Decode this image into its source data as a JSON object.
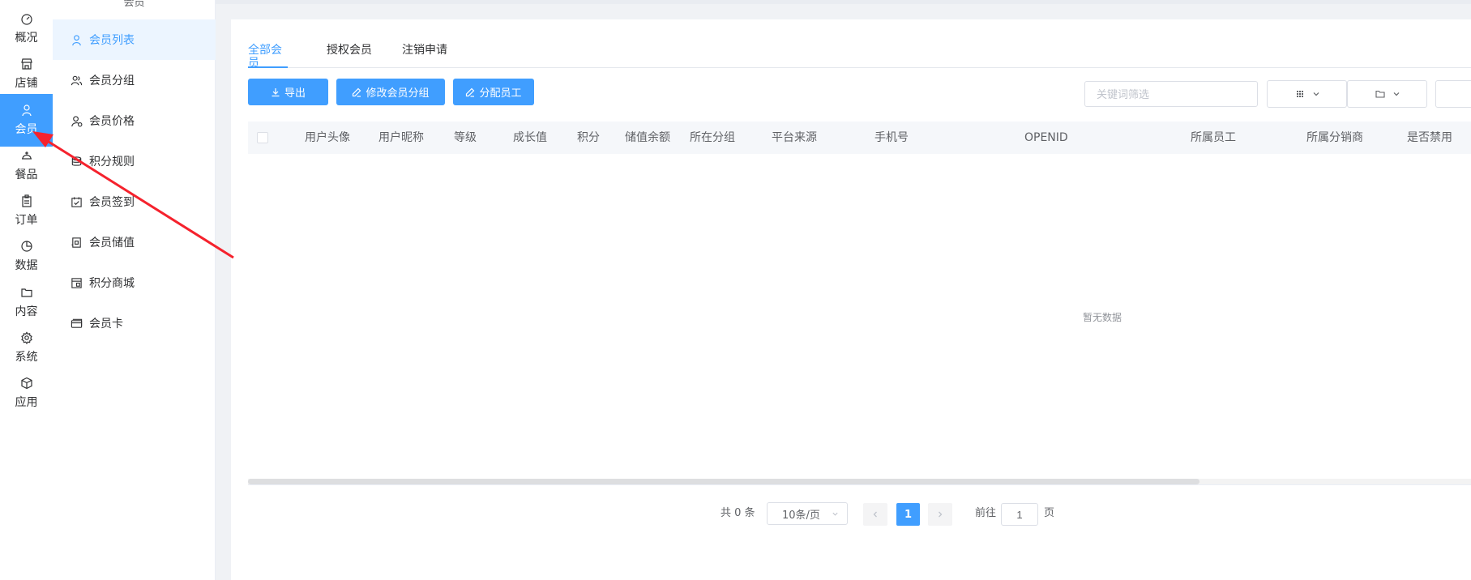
{
  "rail": {
    "items": [
      {
        "label": "概况",
        "icon": "gauge-icon"
      },
      {
        "label": "店铺",
        "icon": "shop-icon"
      },
      {
        "label": "会员",
        "icon": "user-icon",
        "active": true
      },
      {
        "label": "餐品",
        "icon": "food-cover-icon"
      },
      {
        "label": "订单",
        "icon": "clipboard-icon"
      },
      {
        "label": "数据",
        "icon": "pie-chart-icon"
      },
      {
        "label": "内容",
        "icon": "folder-icon"
      },
      {
        "label": "系统",
        "icon": "gear-icon"
      },
      {
        "label": "应用",
        "icon": "cube-icon"
      }
    ]
  },
  "subnav": {
    "title": "会员",
    "items": [
      {
        "label": "会员列表",
        "icon": "user-icon",
        "active": true
      },
      {
        "label": "会员分组",
        "icon": "users-icon"
      },
      {
        "label": "会员价格",
        "icon": "user-price-icon"
      },
      {
        "label": "积分规则",
        "icon": "coins-icon"
      },
      {
        "label": "会员签到",
        "icon": "calendar-check-icon"
      },
      {
        "label": "会员储值",
        "icon": "wallet-icon"
      },
      {
        "label": "积分商城",
        "icon": "store-icon"
      },
      {
        "label": "会员卡",
        "icon": "card-icon"
      }
    ]
  },
  "tabs": [
    {
      "label": "全部会员",
      "active": true
    },
    {
      "label": "授权会员"
    },
    {
      "label": "注销申请"
    }
  ],
  "toolbar": {
    "export_label": "导出",
    "edit_group_label": "修改会员分组",
    "assign_staff_label": "分配员工",
    "search_placeholder": "关键词筛选"
  },
  "table": {
    "columns": [
      "用户头像",
      "用户昵称",
      "等级",
      "成长值",
      "积分",
      "储值余额",
      "所在分组",
      "平台来源",
      "手机号",
      "OPENID",
      "所属员工",
      "所属分销商",
      "是否禁用"
    ],
    "rows": [],
    "empty_text": "暂无数据"
  },
  "pagination": {
    "total_label": "共 0 条",
    "page_size": "10条/页",
    "current_page": "1",
    "goto_prefix": "前往",
    "goto_value": "1",
    "goto_suffix": "页"
  },
  "colors": {
    "accent": "#409eff",
    "annotation_arrow": "#f5222d"
  }
}
